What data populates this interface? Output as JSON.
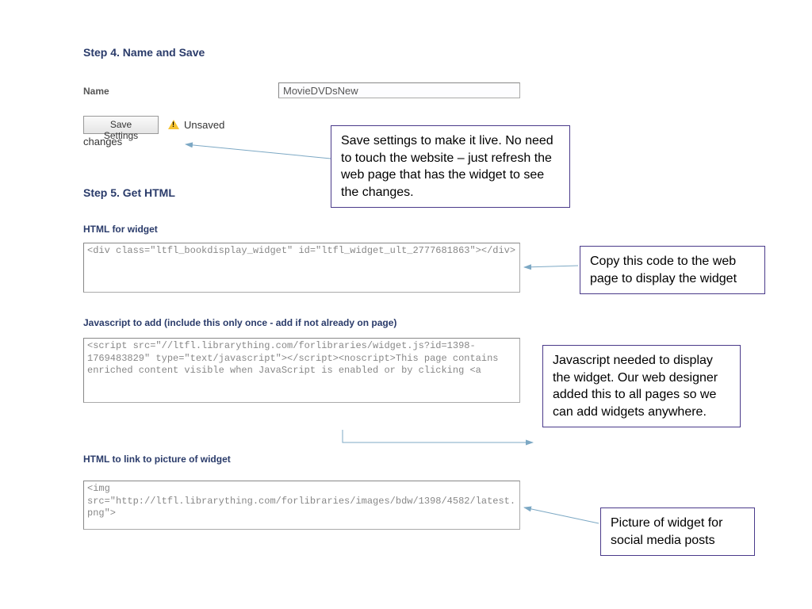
{
  "step4": {
    "heading": "Step 4. Name and Save",
    "name_label": "Name",
    "name_value": "MovieDVDsNew",
    "save_button": "Save Settings",
    "status_unsaved": "Unsaved",
    "status_changes": "changes"
  },
  "step5": {
    "heading": "Step 5. Get HTML",
    "html_label": "HTML for widget",
    "html_code": "<div class=\"ltfl_bookdisplay_widget\" id=\"ltfl_widget_ult_2777681863\"></div>",
    "js_label": "Javascript to add (include this only once - add if not already on page)",
    "js_code": "<script src=\"//ltfl.librarything.com/forlibraries/widget.js?id=1398-1769483829\" type=\"text/javascript\"></script><noscript>This page contains enriched content visible when JavaScript is enabled or by clicking <a",
    "link_label": "HTML to link to picture of widget",
    "link_code": "<img src=\"http://ltfl.librarything.com/forlibraries/images/bdw/1398/4582/latest.png\">"
  },
  "callouts": {
    "save": "Save settings to make it live.  No need to touch the website – just refresh the web page that has the widget to see the changes.",
    "copy_html": "Copy this code to the web page to display the widget",
    "javascript": "Javascript needed to display the widget.  Our web designer added this to all pages so we can add widgets anywhere.",
    "picture": "Picture of widget for social media posts"
  }
}
